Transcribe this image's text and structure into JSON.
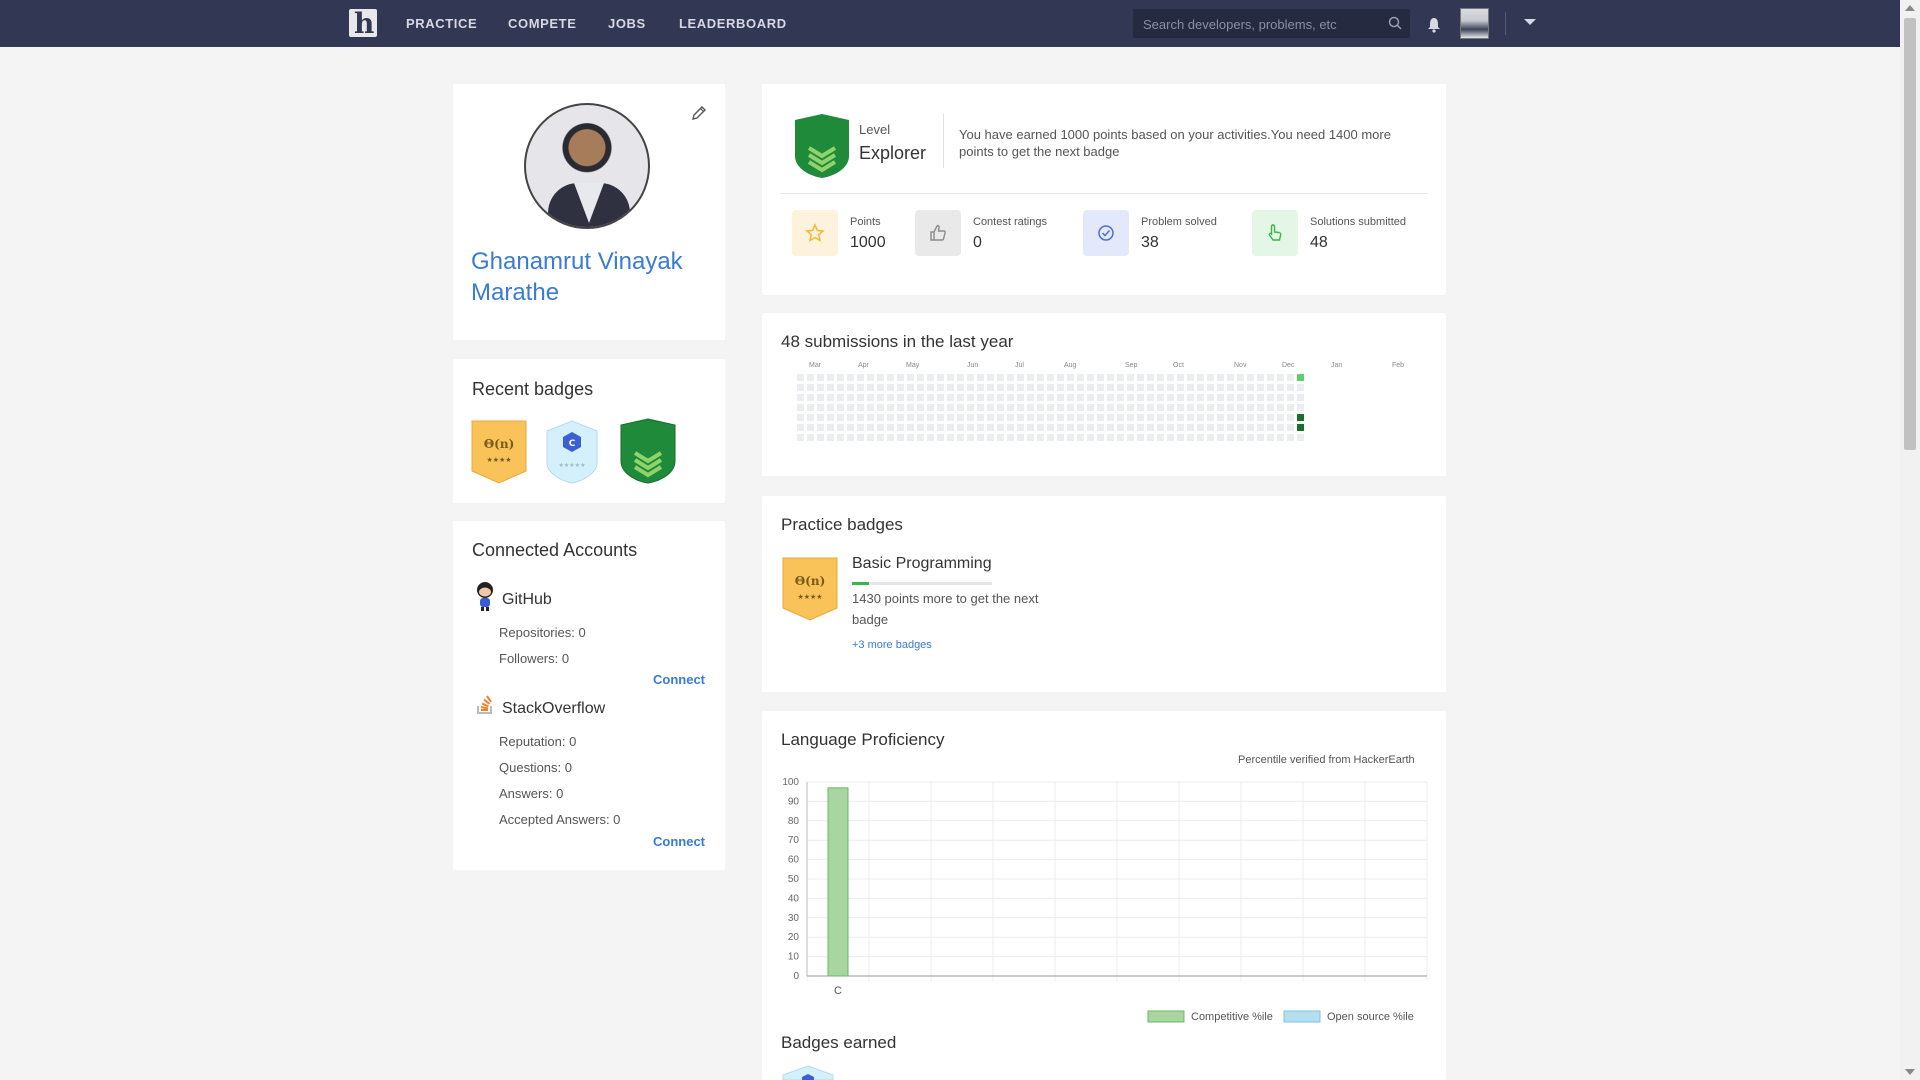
{
  "nav": {
    "logo_letter": "h",
    "items": [
      "PRACTICE",
      "COMPETE",
      "JOBS",
      "LEADERBOARD"
    ],
    "search_placeholder": "Search developers, problems, etc"
  },
  "profile": {
    "name_line1": "Ghanamrut Vinayak",
    "name_line2": "Marathe"
  },
  "recent_badges": {
    "title": "Recent badges",
    "badge1_text": "Θ(n)",
    "badge2_text": "C"
  },
  "connected": {
    "title": "Connected Accounts",
    "github": {
      "name": "GitHub",
      "stats": [
        "Repositories: 0",
        "Followers: 0"
      ],
      "connect": "Connect"
    },
    "stackoverflow": {
      "name": "StackOverflow",
      "stats": [
        "Reputation: 0",
        "Questions: 0",
        "Answers: 0",
        "Accepted Answers: 0"
      ],
      "connect": "Connect"
    }
  },
  "level": {
    "label": "Level",
    "name": "Explorer",
    "message_line1": "You have earned 1000 points based on your activities.You need 1400 more",
    "message_line2": "points to get the next badge",
    "stats": [
      {
        "label": "Points",
        "value": "1000",
        "icon": "star-icon",
        "color": "#f7b731"
      },
      {
        "label": "Contest ratings",
        "value": "0",
        "icon": "thumbs-up-icon",
        "color": "#9a9a9a"
      },
      {
        "label": "Problem solved",
        "value": "38",
        "icon": "check-circle-icon",
        "color": "#4a6fd6"
      },
      {
        "label": "Solutions submitted",
        "value": "48",
        "icon": "pointer-hand-icon",
        "color": "#3bb54a"
      }
    ]
  },
  "submissions": {
    "title": "48 submissions in the last year",
    "months": [
      "Mar",
      "Apr",
      "May",
      "Jun",
      "Jul",
      "Aug",
      "Sep",
      "Oct",
      "Nov",
      "Dec",
      "Jan",
      "Feb"
    ]
  },
  "practice_badges": {
    "title": "Practice badges",
    "badge_text": "Θ(n)",
    "name": "Basic Programming",
    "sub_line1": "1430 points more to get the next",
    "sub_line2": "badge",
    "more": "+3 more badges"
  },
  "language": {
    "title": "Language Proficiency",
    "note": "Percentile verified from HackerEarth"
  },
  "badges_earned": {
    "title": "Badges earned"
  },
  "chart_data": {
    "type": "bar",
    "categories": [
      "C"
    ],
    "series": [
      {
        "name": "Competitive %ile",
        "values": [
          97
        ],
        "color": "#a8d5a0"
      },
      {
        "name": "Open source %ile",
        "values": [
          0
        ],
        "color": "#b3dff0"
      }
    ],
    "ylim": [
      0,
      100
    ],
    "yticks": [
      "0",
      "10",
      "20",
      "30",
      "40",
      "50",
      "60",
      "70",
      "80",
      "90",
      "100"
    ],
    "legend": "bottom-right",
    "grid": true
  }
}
